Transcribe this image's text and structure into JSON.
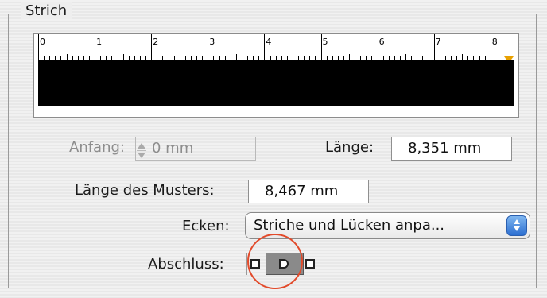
{
  "panel": {
    "title": "Strich",
    "ruler": {
      "labels": [
        "0",
        "1",
        "2",
        "3",
        "4",
        "5",
        "6",
        "7",
        "8"
      ],
      "marker_color": "#e8a000",
      "pattern_color": "#000000"
    },
    "fields": {
      "anfang": {
        "label": "Anfang:",
        "value": "0 mm",
        "disabled": true
      },
      "laenge": {
        "label": "Länge:",
        "value": "8,351 mm"
      },
      "musterlaenge": {
        "label": "Länge des Musters:",
        "value": "8,467 mm"
      }
    },
    "ecken": {
      "label": "Ecken:",
      "selected": "Striche und Lücken anpa..."
    },
    "abschluss": {
      "label": "Abschluss:",
      "options": [
        "butt-cap-icon",
        "round-cap-icon",
        "projecting-cap-icon"
      ],
      "selected_index": 1
    },
    "highlight_color": "#e24a2a"
  }
}
